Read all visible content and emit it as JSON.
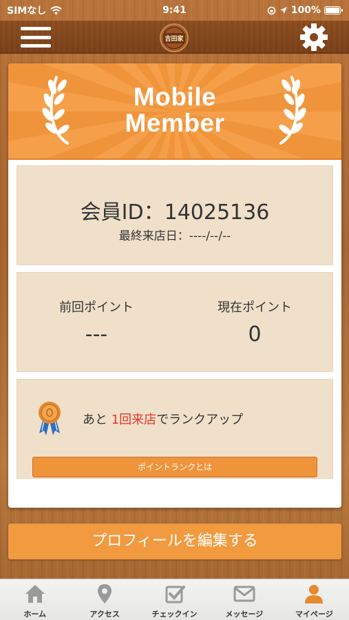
{
  "status_bar": {
    "carrier": "SIMなし",
    "time": "9:41",
    "battery": "100%"
  },
  "nav": {
    "logo_text": "吉田家"
  },
  "banner": {
    "title_line1": "Mobile",
    "title_line2": "Member"
  },
  "member": {
    "id_label": "会員ID：14025136",
    "last_visit": "最終来店日：----/--/--"
  },
  "points": {
    "previous_label": "前回ポイント",
    "previous_value": "---",
    "current_label": "現在ポイント",
    "current_value": "0"
  },
  "rank": {
    "text_before": "あと ",
    "highlight": "1回来店",
    "text_after": "でランクアップ",
    "button_label": "ポイントランクとは"
  },
  "edit_profile_label": "プロフィールを編集する",
  "tabs": [
    {
      "label": "ホーム",
      "icon": "home-icon",
      "active": false
    },
    {
      "label": "アクセス",
      "icon": "location-pin-icon",
      "active": false
    },
    {
      "label": "チェックイン",
      "icon": "checkin-icon",
      "active": false
    },
    {
      "label": "メッセージ",
      "icon": "envelope-icon",
      "active": false
    },
    {
      "label": "マイページ",
      "icon": "person-icon",
      "active": true
    }
  ],
  "colors": {
    "accent": "#f0943b",
    "highlight": "#e8332a",
    "panel": "#f0e0ca",
    "tab_icon": "#9a9a9a",
    "tab_icon_active": "#e58a2e"
  }
}
